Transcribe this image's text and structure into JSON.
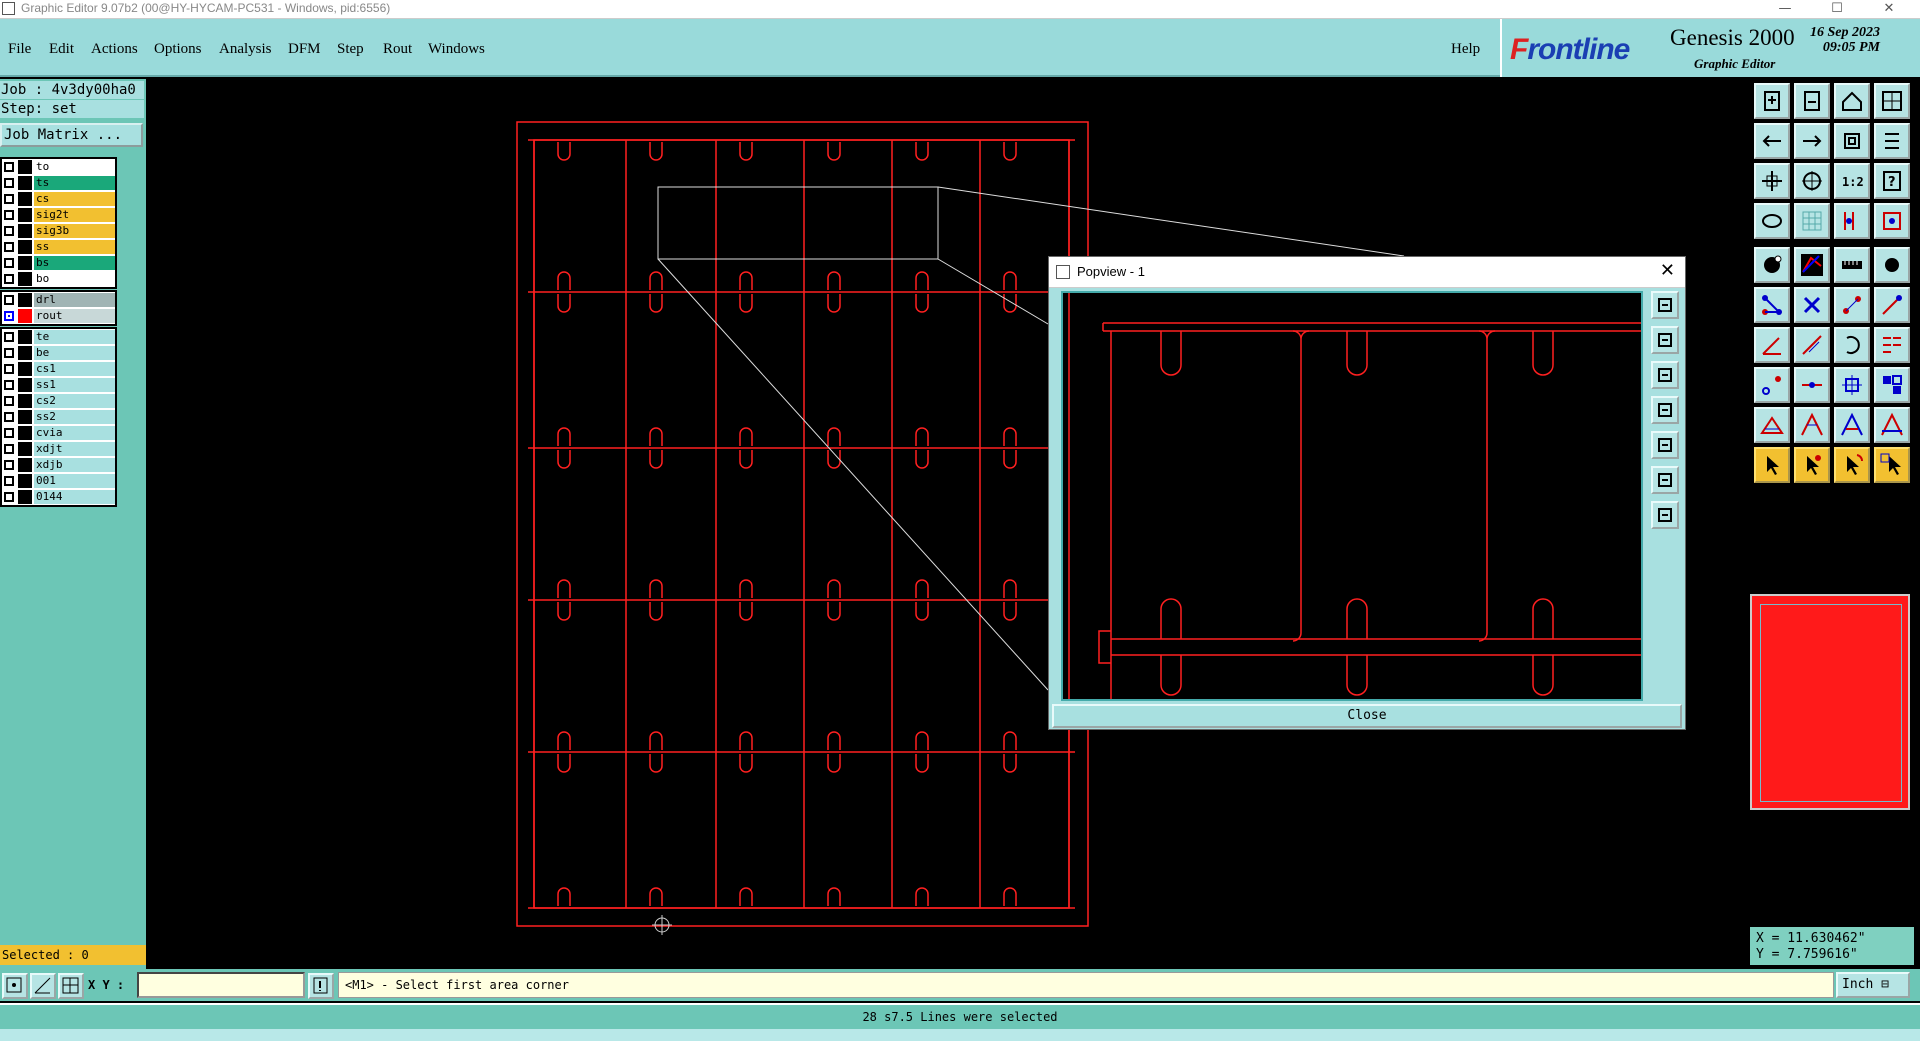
{
  "window": {
    "title": "Graphic Editor 9.07b2 (00@HY-HYCAM-PC531 - Windows, pid:6556)",
    "minimize": "—",
    "maximize": "☐",
    "close": "✕"
  },
  "menu": [
    "File",
    "Edit",
    "Actions",
    "Options",
    "Analysis",
    "DFM",
    "Step",
    "Rout",
    "Windows"
  ],
  "help": "Help",
  "brand": {
    "logo_prefix": "F",
    "logo": "rontline",
    "product": "Genesis 2000",
    "subtitle": "Graphic Editor",
    "date": "16 Sep 2023",
    "time": "09:05 PM"
  },
  "job": {
    "job_line": "Job : 4v3dy00ha0",
    "step_line": "Step: set",
    "matrix_button": "Job Matrix ..."
  },
  "layers": {
    "group1": [
      {
        "name": "to",
        "color": "#ffffff",
        "swatch": "#000000"
      },
      {
        "name": "ts",
        "color": "#1aa87a",
        "swatch": "#000000"
      },
      {
        "name": "cs",
        "color": "#f2c030",
        "swatch": "#000000"
      },
      {
        "name": "sig2t",
        "color": "#f2c030",
        "swatch": "#000000"
      },
      {
        "name": "sig3b",
        "color": "#f2c030",
        "swatch": "#000000"
      },
      {
        "name": "ss",
        "color": "#f2c030",
        "swatch": "#000000"
      },
      {
        "name": "bs",
        "color": "#1aa87a",
        "swatch": "#000000"
      },
      {
        "name": "bo",
        "color": "#ffffff",
        "swatch": "#000000"
      }
    ],
    "group2": [
      {
        "name": "drl",
        "color": "#a0b4b4",
        "swatch": "#000000",
        "on": false
      },
      {
        "name": "rout",
        "color": "#c8d8d8",
        "swatch": "#ff0000",
        "on": true
      }
    ],
    "group3": [
      {
        "name": "te",
        "color": "#a8e0e0",
        "swatch": "#000000"
      },
      {
        "name": "be",
        "color": "#a8e0e0",
        "swatch": "#000000"
      },
      {
        "name": "cs1",
        "color": "#a8e0e0",
        "swatch": "#000000"
      },
      {
        "name": "ss1",
        "color": "#a8e0e0",
        "swatch": "#000000"
      },
      {
        "name": "cs2",
        "color": "#a8e0e0",
        "swatch": "#000000"
      },
      {
        "name": "ss2",
        "color": "#a8e0e0",
        "swatch": "#000000"
      },
      {
        "name": "cvia",
        "color": "#a8e0e0",
        "swatch": "#000000"
      },
      {
        "name": "xdjt",
        "color": "#a8e0e0",
        "swatch": "#000000"
      },
      {
        "name": "xdjb",
        "color": "#a8e0e0",
        "swatch": "#000000"
      },
      {
        "name": "001",
        "color": "#a8e0e0",
        "swatch": "#000000"
      },
      {
        "name": "0144",
        "color": "#a8e0e0",
        "swatch": "#000000"
      }
    ]
  },
  "selected": "Selected : 0",
  "xy_label": "X Y :",
  "xy_value": "",
  "prompt": "<M1> - Select first area corner",
  "units": "Inch ⊟",
  "status": "28 s7.5 Lines were selected",
  "coords": {
    "x": "X = 11.630462\"",
    "y": "Y = 7.759616\""
  },
  "popview": {
    "title": "Popview - 1",
    "close_label": "Close",
    "close_x": "✕"
  },
  "colors": {
    "rout": "#ff2020",
    "panel": "#6cc6b6",
    "menu": "#99dada",
    "highlight": "#f2c030"
  },
  "toolbar_icons": [
    "zoom-home-icon",
    "zoom-in-icon",
    "zoom-out-icon",
    "view-icon",
    "pan-left-icon",
    "pan-right-icon",
    "redraw-icon",
    "snap-icon",
    "fit-icon",
    "zoom-fit-icon",
    "scale-icon",
    "help-icon",
    "measure-icon",
    "grid-icon",
    "layers-icon",
    "properties-icon",
    "select-icon",
    "draw-icon",
    "ruler-icon",
    "pad-icon",
    "connect-icon",
    "cross-icon",
    "add-point-icon",
    "line-icon",
    "angle-icon",
    "slope-icon",
    "arc-icon",
    "flip-icon",
    "node-icon",
    "segment-icon",
    "fill-icon",
    "array-icon",
    "triangle-icon",
    "polygon-icon",
    "area-icon",
    "outline-icon",
    "pointer-icon",
    "pointer-move-icon",
    "pointer-rotate-icon",
    "pointer-multi-icon"
  ]
}
